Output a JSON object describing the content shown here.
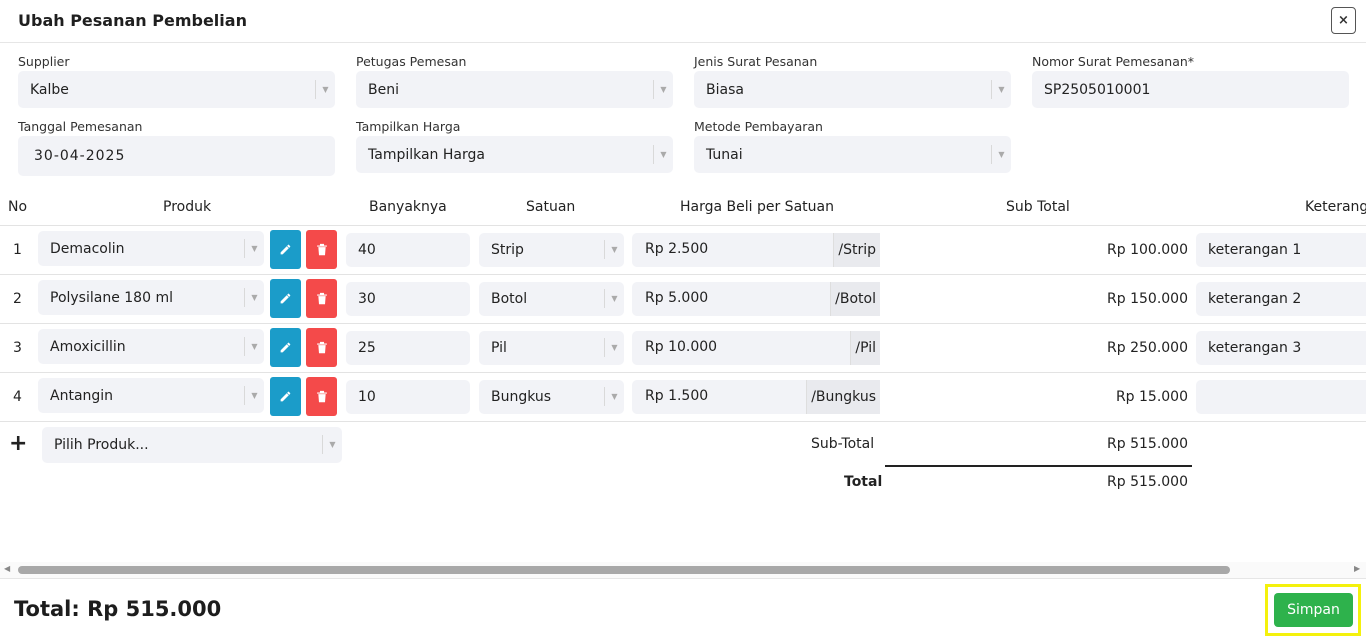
{
  "modal": {
    "title": "Ubah Pesanan Pembelian",
    "close_label": "×"
  },
  "form": {
    "supplier": {
      "label": "Supplier",
      "value": "Kalbe"
    },
    "petugas": {
      "label": "Petugas Pemesan",
      "value": "Beni"
    },
    "jenis": {
      "label": "Jenis Surat Pesanan",
      "value": "Biasa"
    },
    "nomor": {
      "label": "Nomor Surat Pemesanan*",
      "value": "SP2505010001"
    },
    "tanggal": {
      "label": "Tanggal Pemesanan",
      "value": "30-04-2025"
    },
    "tampilkan": {
      "label": "Tampilkan Harga",
      "value": "Tampilkan Harga"
    },
    "metode": {
      "label": "Metode Pembayaran",
      "value": "Tunai"
    }
  },
  "table": {
    "headers": [
      "No",
      "Produk",
      "Banyaknya",
      "Satuan",
      "Harga Beli per Satuan",
      "Sub Total",
      "Keterang"
    ],
    "rows": [
      {
        "no": "1",
        "produk": "Demacolin",
        "qty": "40",
        "satuan": "Strip",
        "harga": "Rp 2.500",
        "unit": "/Strip",
        "subtotal": "Rp 100.000",
        "keterangan": "keterangan 1"
      },
      {
        "no": "2",
        "produk": "Polysilane 180 ml",
        "qty": "30",
        "satuan": "Botol",
        "harga": "Rp 5.000",
        "unit": "/Botol",
        "subtotal": "Rp 150.000",
        "keterangan": "keterangan 2"
      },
      {
        "no": "3",
        "produk": "Amoxicillin",
        "qty": "25",
        "satuan": "Pil",
        "harga": "Rp 10.000",
        "unit": "/Pil",
        "subtotal": "Rp 250.000",
        "keterangan": "keterangan 3"
      },
      {
        "no": "4",
        "produk": "Antangin",
        "qty": "10",
        "satuan": "Bungkus",
        "harga": "Rp 1.500",
        "unit": "/Bungkus",
        "subtotal": "Rp 15.000",
        "keterangan": ""
      }
    ],
    "add_icon": "+",
    "new_product_placeholder": "Pilih Produk...",
    "subtotal_label": "Sub-Total",
    "subtotal_value": "Rp 515.000",
    "total_label": "Total",
    "total_value": "Rp 515.000"
  },
  "footer": {
    "total_text": "Total: Rp 515.000",
    "save_label": "Simpan"
  },
  "colors": {
    "edit": "#1b9cc9",
    "delete": "#f44a4a",
    "save": "#2eb24c",
    "highlight": "#f4f10c"
  },
  "icons": {
    "edit": "pencil-icon",
    "delete": "trash-icon",
    "close": "close-icon",
    "add": "plus-icon",
    "dropdown": "caret-down-icon"
  }
}
